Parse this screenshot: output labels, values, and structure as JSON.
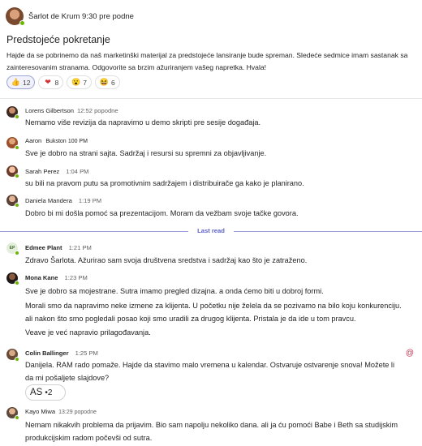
{
  "post": {
    "author": "Šarlot de Krum",
    "time": "9:30 pre podne",
    "title": "Predstojeće pokretanje",
    "body": "Hajde da se pobrinemo da naš marketinški materijal za predstojeće lansiranje bude spreman. Sledeće sedmice imam sastanak sa zainteresovanim stranama. Odgovorite sa brzim ažuriranjem vašeg napretka. Hvala!",
    "reactions": [
      {
        "icon": "thumbs-up-icon",
        "count": "12"
      },
      {
        "icon": "heart-icon",
        "count": "8"
      },
      {
        "icon": "surprised-face-icon",
        "count": "7"
      },
      {
        "icon": "laughing-face-icon",
        "count": "6"
      }
    ]
  },
  "replies": [
    {
      "author": "Lorens Gilbertson",
      "time": "12:52 popodne",
      "text": "Nemamo više revizija da napravimo u demo skripti pre sesije događaja."
    },
    {
      "author": "Aaron",
      "extra": "Bukston",
      "time": "100 PM",
      "text": "Sve je dobro na strani sajta. Sadržaj i resursi su spremni za objavljivanje."
    },
    {
      "author": "Sarah Perez",
      "time": "1:04 PM",
      "text": "su bili na pravom putu sa promotivnim sadržajem i distribuirače ga kako je planirano."
    },
    {
      "author": "Daniela Mandera",
      "time": "1:19 PM",
      "text": "Dobro bi mi došla pomoć sa prezentacijom. Moram da vežbam svoje tačke govora."
    },
    {
      "author": "Edmee Plant",
      "time": "1:21 PM",
      "initials": "EP",
      "text": "Zdravo Šarlota. Ažurirao sam svoja društvena sredstva i sadržaj kao što je zatraženo."
    },
    {
      "author": "Mona Kane",
      "time": "1:23 PM",
      "texts": [
        "Sve je dobro sa mojestrane. Sutra imamo pregled dizajna. a onda ćemo biti u dobroj formi.",
        "Morali smo da napravimo neke izmene za klijenta. U početku nije želela da se pozivamo na bilo koju konkurenciju. ali nakon što smo pogledali posao koji smo uradili za drugog klijenta. Pristala je da ide u tom pravcu.",
        "Veave je već napravio prilagođavanja."
      ]
    },
    {
      "author": "Colin Ballinger",
      "time": "1:25 PM",
      "text": "Danijela. RAM rado pomaže. Hajde da stavimo malo vremena u kalendar. Ostvaruje ostvarenje snova! Možete li da mi pošaljete slajdove?",
      "mention_icon": "@",
      "chip": {
        "label": "AS",
        "extra": "•2"
      }
    },
    {
      "author": "Kayo Miwa",
      "time": "13:29 popodne",
      "text": "Nemam nikakvih problema da prijavim. Bio sam napolju nekoliko dana. ali ja ću pomoći Babe i Beth sa studijskim produkcijskim radom počevši od sutra."
    }
  ],
  "last_read_label": "Last read",
  "colors": {
    "accent": "#5b5fc7",
    "presence": "#6bb700",
    "mention": "#c4314b"
  }
}
